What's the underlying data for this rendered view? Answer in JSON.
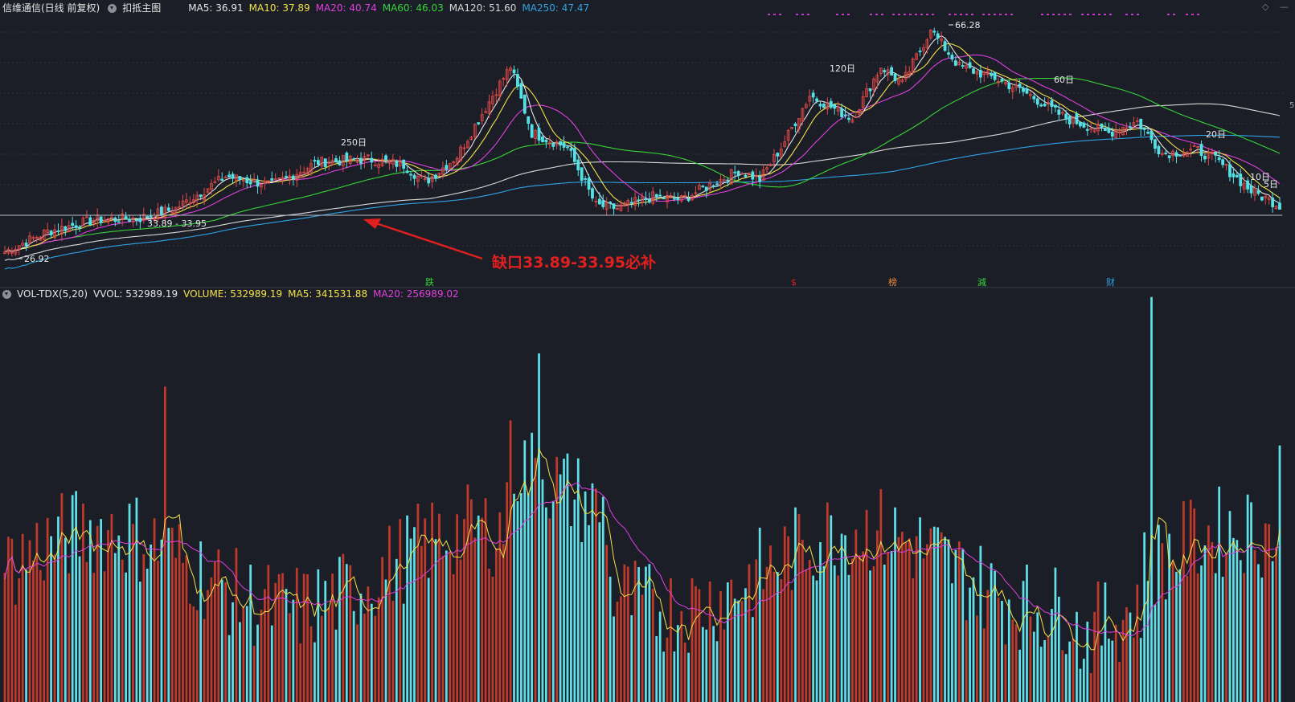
{
  "header": {
    "stock_name": "信维通信(日线 前复权)",
    "tool_button": "扣抵主图",
    "ma_readouts": [
      {
        "label": "MA5: 36.91",
        "color": "#e6e6e6"
      },
      {
        "label": "MA10: 37.89",
        "color": "#f3e24a"
      },
      {
        "label": "MA20: 40.74",
        "color": "#e040e0"
      },
      {
        "label": "MA60: 46.03",
        "color": "#37d43a"
      },
      {
        "label": "MA120: 51.60",
        "color": "#d8d8d8"
      },
      {
        "label": "MA250: 47.47",
        "color": "#2fa3e6"
      }
    ]
  },
  "volume_header": {
    "indicator": "VOL-TDX(5,20)",
    "readouts": [
      {
        "label": "VVOL: 532989.19",
        "color": "#e6e6e6"
      },
      {
        "label": "VOLUME: 532989.19",
        "color": "#f3e24a"
      },
      {
        "label": "MA5: 341531.88",
        "color": "#f3e24a"
      },
      {
        "label": "MA20: 256989.02",
        "color": "#e040e0"
      }
    ]
  },
  "window_controls": [
    "◇",
    "—"
  ],
  "annotation": {
    "text": "缺口33.89-33.95必补",
    "color": "#e02020"
  },
  "markers": [
    {
      "text": "跌",
      "color": "#37d43a"
    },
    {
      "text": "$",
      "color": "#e02020"
    },
    {
      "text": "榜",
      "color": "#f08a3a"
    },
    {
      "text": "減",
      "color": "#37d43a"
    },
    {
      "text": "财",
      "color": "#2fa3e6"
    }
  ],
  "price_labels": {
    "high": "66.28",
    "low": "26.92",
    "gap": "33.89 - 33.95",
    "dd_250": "250日",
    "dd_120": "120日",
    "dd_60": "60日",
    "dd_20": "20日",
    "dd_10": "10日",
    "dd_5": "5日",
    "right_edge": "5"
  },
  "colors": {
    "background": "#1b1e26",
    "grid": "#2c313b",
    "up": "#e04848",
    "down": "#54e1e6",
    "volume_up": "#c0392b",
    "volume_down": "#5fe0e8",
    "ma5": "#e6e6e6",
    "ma10": "#f3e24a",
    "ma20": "#e040e0",
    "ma60": "#37d43a",
    "ma120": "#d8d8d8",
    "ma250": "#2fa3e6"
  },
  "chart_data": [
    {
      "type": "candlestick",
      "title": "信维通信(日线 前复权)",
      "y_marked": {
        "high": 66.28,
        "low": 26.92,
        "gap_low": 33.89,
        "gap_high": 33.95
      },
      "y_range": [
        25,
        68
      ],
      "control_points": [
        {
          "i": 0,
          "close": 28.0
        },
        {
          "i": 12,
          "close": 31.5
        },
        {
          "i": 25,
          "close": 33.5
        },
        {
          "i": 38,
          "close": 33.8
        },
        {
          "i": 48,
          "close": 35.5
        },
        {
          "i": 62,
          "close": 41.0
        },
        {
          "i": 75,
          "close": 39.5
        },
        {
          "i": 88,
          "close": 43.5
        },
        {
          "i": 102,
          "close": 44.0
        },
        {
          "i": 112,
          "close": 43.0
        },
        {
          "i": 118,
          "close": 40.0
        },
        {
          "i": 127,
          "close": 44.5
        },
        {
          "i": 137,
          "close": 55.0
        },
        {
          "i": 142,
          "close": 60.0
        },
        {
          "i": 148,
          "close": 48.5
        },
        {
          "i": 158,
          "close": 46.0
        },
        {
          "i": 166,
          "close": 36.0
        },
        {
          "i": 172,
          "close": 35.5
        },
        {
          "i": 182,
          "close": 37.5
        },
        {
          "i": 190,
          "close": 37.0
        },
        {
          "i": 198,
          "close": 39.5
        },
        {
          "i": 206,
          "close": 42.0
        },
        {
          "i": 212,
          "close": 40.5
        },
        {
          "i": 218,
          "close": 46.0
        },
        {
          "i": 226,
          "close": 55.0
        },
        {
          "i": 232,
          "close": 53.0
        },
        {
          "i": 238,
          "close": 51.0
        },
        {
          "i": 246,
          "close": 60.0
        },
        {
          "i": 252,
          "close": 57.0
        },
        {
          "i": 260,
          "close": 66.28
        },
        {
          "i": 268,
          "close": 60.0
        },
        {
          "i": 278,
          "close": 58.0
        },
        {
          "i": 288,
          "close": 55.0
        },
        {
          "i": 298,
          "close": 51.0
        },
        {
          "i": 310,
          "close": 48.5
        },
        {
          "i": 318,
          "close": 50.5
        },
        {
          "i": 325,
          "close": 45.0
        },
        {
          "i": 335,
          "close": 45.5
        },
        {
          "i": 340,
          "close": 44.0
        },
        {
          "i": 350,
          "close": 38.5
        },
        {
          "i": 358,
          "close": 36.0
        }
      ],
      "candle_count": 359
    },
    {
      "type": "bar",
      "title": "VOL-TDX(5,20)",
      "last_volume": 532989.19,
      "ma5": 341531.88,
      "ma20": 256989.02,
      "y_max": 1200000
    }
  ]
}
